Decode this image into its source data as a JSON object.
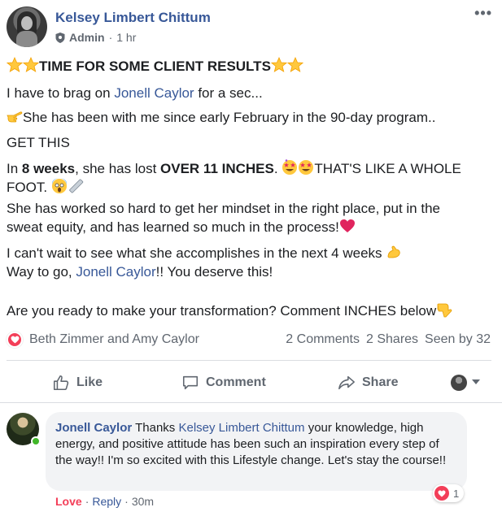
{
  "post": {
    "author": "Kelsey Limbert Chittum",
    "role": "Admin",
    "time": "1 hr",
    "more_label": "•••",
    "headline": "TIME FOR SOME CLIENT RESULTS",
    "line_brag_pre": "I have to brag on ",
    "line_brag_link": "Jonell Caylor",
    "line_brag_post": " for a sec...",
    "line_since": "She has been with me since early February in the 90-day program..",
    "line_get": "GET THIS",
    "line_in": "In ",
    "weeks": "8 weeks",
    "line_lost": ", she has lost ",
    "inches": "OVER 11 INCHES",
    "line_period": ". ",
    "line_foot": "THAT'S LIKE A WHOLE",
    "line_foot2": "FOOT. ",
    "line_worked": "She has worked so hard to get her mindset in the right place, put in the",
    "line_sweat": "sweat equity, and has learned so much in the process!",
    "line_wait": "I can't wait to see what she accomplishes in the next 4 weeks ",
    "line_way_pre": "Way to go, ",
    "line_way_link": "Jonell Caylor",
    "line_way_post": "!! You deserve this!",
    "line_ready": "Are you ready to make your transformation? Comment INCHES below"
  },
  "reactions": {
    "names": "Beth Zimmer and Amy Caylor",
    "comments": "2 Comments",
    "shares": "2 Shares",
    "seen": "Seen by 32"
  },
  "actions": {
    "like": "Like",
    "comment": "Comment",
    "share": "Share"
  },
  "comment": {
    "author": "Jonell Caylor",
    "text_pre": " Thanks ",
    "mention": "Kelsey Limbert Chittum",
    "text_post": " your knowledge, high energy, and positive attitude has been such an inspiration every step of the way!! I'm so excited with this Lifestyle change. Let's stay the course!!",
    "reaction_count": "1",
    "love": "Love",
    "dot": "·",
    "reply": "Reply",
    "time": "30m"
  },
  "colors": {
    "link": "#385898",
    "love": "#f33e58",
    "muted": "#606770"
  }
}
